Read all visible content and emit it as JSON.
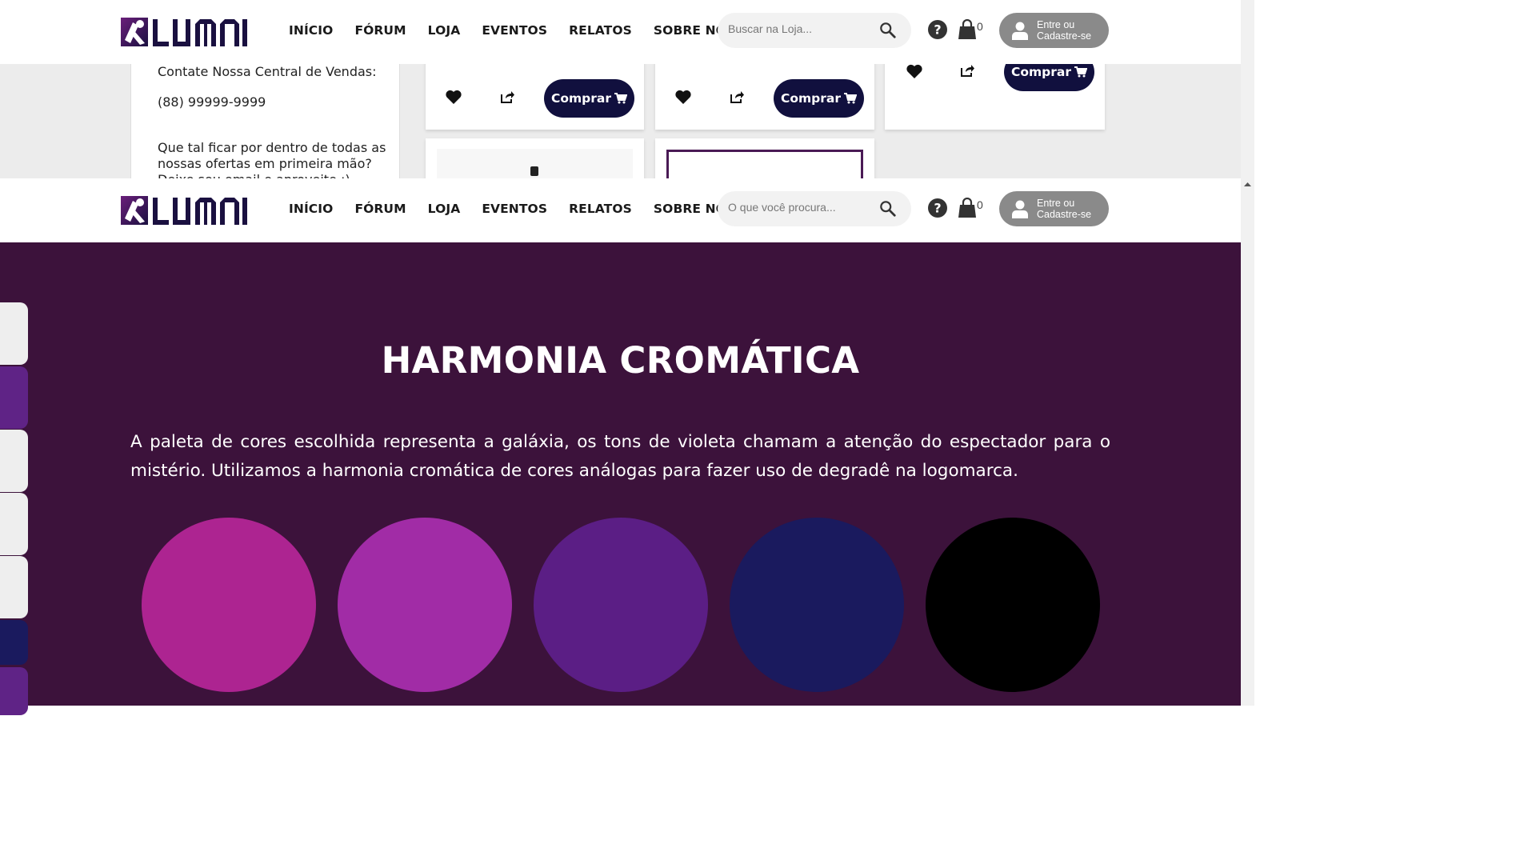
{
  "header_top": {
    "logo_text": "LUMNI",
    "nav": [
      "INÍCIO",
      "FÓRUM",
      "LOJA",
      "EVENTOS",
      "RELATOS",
      "SOBRE NÓS"
    ],
    "search_placeholder": "Buscar na Loja...",
    "cart_count": "0",
    "login_line1": "Entre ou",
    "login_line2": "Cadastre-se"
  },
  "store_view": {
    "contact_label": "Contate Nossa Central de Vendas:",
    "contact_phone": "(88) 99999-9999",
    "newsletter_line1": "Que tal ficar por dentro de todas as",
    "newsletter_line2": "nossas ofertas em primeira mão?",
    "newsletter_line3": "Deixe seu email e aproveite :)",
    "buy_label": "Comprar"
  },
  "header_second": {
    "logo_text": "LUMNI",
    "nav": [
      "INÍCIO",
      "FÓRUM",
      "LOJA",
      "EVENTOS",
      "RELATOS",
      "SOBRE NÓS"
    ],
    "search_placeholder": "O que você procura...",
    "cart_count": "0",
    "login_line1": "Entre ou",
    "login_line2": "Cadastre-se"
  },
  "harmony": {
    "title": "HARMONIA CROMÁTICA",
    "description": "A paleta de cores escolhida representa a galáxia, os tons de violeta chamam a atenção do espectador para o mistério. Utilizamos a harmonia cromática de cores análogas para fazer uso de degradê na logomarca.",
    "background": "#3c123b",
    "palette": [
      "#ad2491",
      "#a12ca6",
      "#5b1e85",
      "#1a1a5e",
      "#000000"
    ]
  },
  "side_tabs": [
    "#eeeeee",
    "#5f2386",
    "#eeeeee",
    "#eeeeee",
    "#eeeeee",
    "#1a1a5e",
    "#5f2386"
  ],
  "colors": {
    "accent_dark": "#11103e",
    "login_bg": "#8a8a8a"
  }
}
